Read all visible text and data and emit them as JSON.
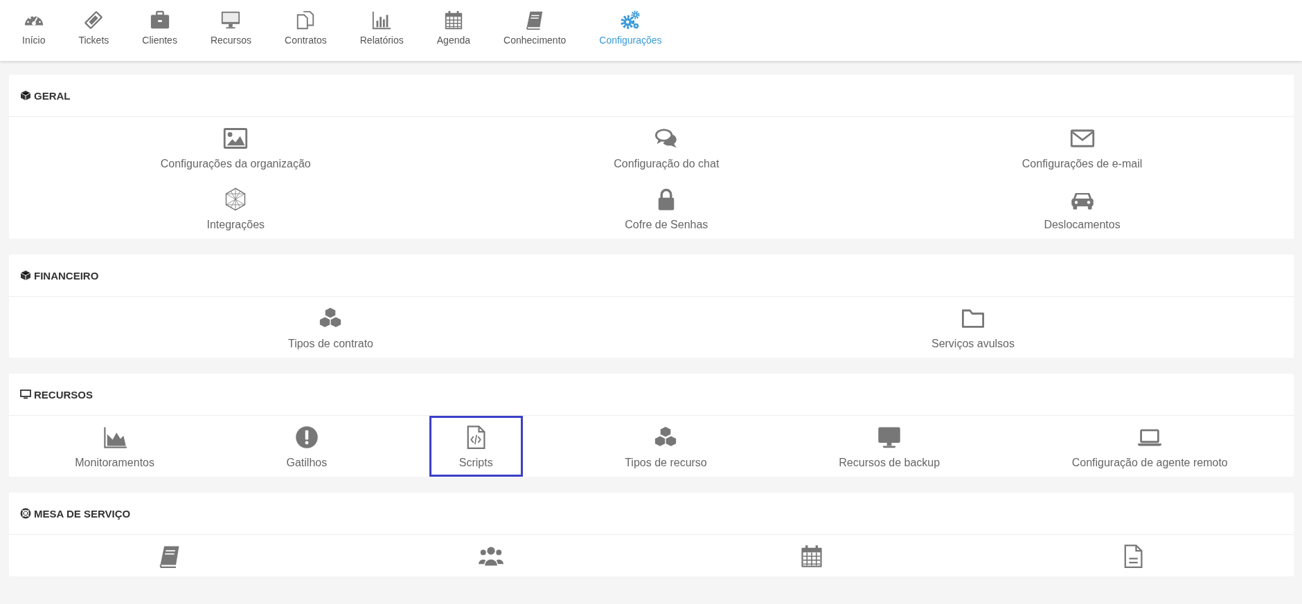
{
  "nav": [
    {
      "label": "Início",
      "selected": false
    },
    {
      "label": "Tickets",
      "selected": false
    },
    {
      "label": "Clientes",
      "selected": false
    },
    {
      "label": "Recursos",
      "selected": false
    },
    {
      "label": "Contratos",
      "selected": false
    },
    {
      "label": "Relatórios",
      "selected": false
    },
    {
      "label": "Agenda",
      "selected": false
    },
    {
      "label": "Conhecimento",
      "selected": false
    },
    {
      "label": "Configurações",
      "selected": true
    }
  ],
  "sections": [
    {
      "title": "GERAL",
      "rows": [
        [
          {
            "label": "Configurações da organização",
            "selected": false
          },
          {
            "label": "Configuração do chat",
            "selected": false
          },
          {
            "label": "Configurações de e-mail",
            "selected": false
          }
        ],
        [
          {
            "label": "Integrações",
            "selected": false
          },
          {
            "label": "Cofre de Senhas",
            "selected": false
          },
          {
            "label": "Deslocamentos",
            "selected": false
          }
        ]
      ]
    },
    {
      "title": "FINANCEIRO",
      "rows": [
        [
          {
            "label": "Tipos de contrato",
            "selected": false
          },
          {
            "label": "Serviços avulsos",
            "selected": false
          }
        ]
      ]
    },
    {
      "title": "RECURSOS",
      "rows": [
        [
          {
            "label": "Monitoramentos",
            "selected": false
          },
          {
            "label": "Gatilhos",
            "selected": false
          },
          {
            "label": "Scripts",
            "selected": true
          },
          {
            "label": "Tipos de recurso",
            "selected": false
          },
          {
            "label": "Recursos de backup",
            "selected": false
          },
          {
            "label": "Configuração de agente remoto",
            "selected": false
          }
        ]
      ]
    },
    {
      "title": "MESA DE SERVIÇO",
      "rows": [
        [
          {
            "selected": false
          },
          {
            "selected": false
          },
          {
            "selected": false
          },
          {
            "selected": false
          }
        ]
      ]
    }
  ]
}
